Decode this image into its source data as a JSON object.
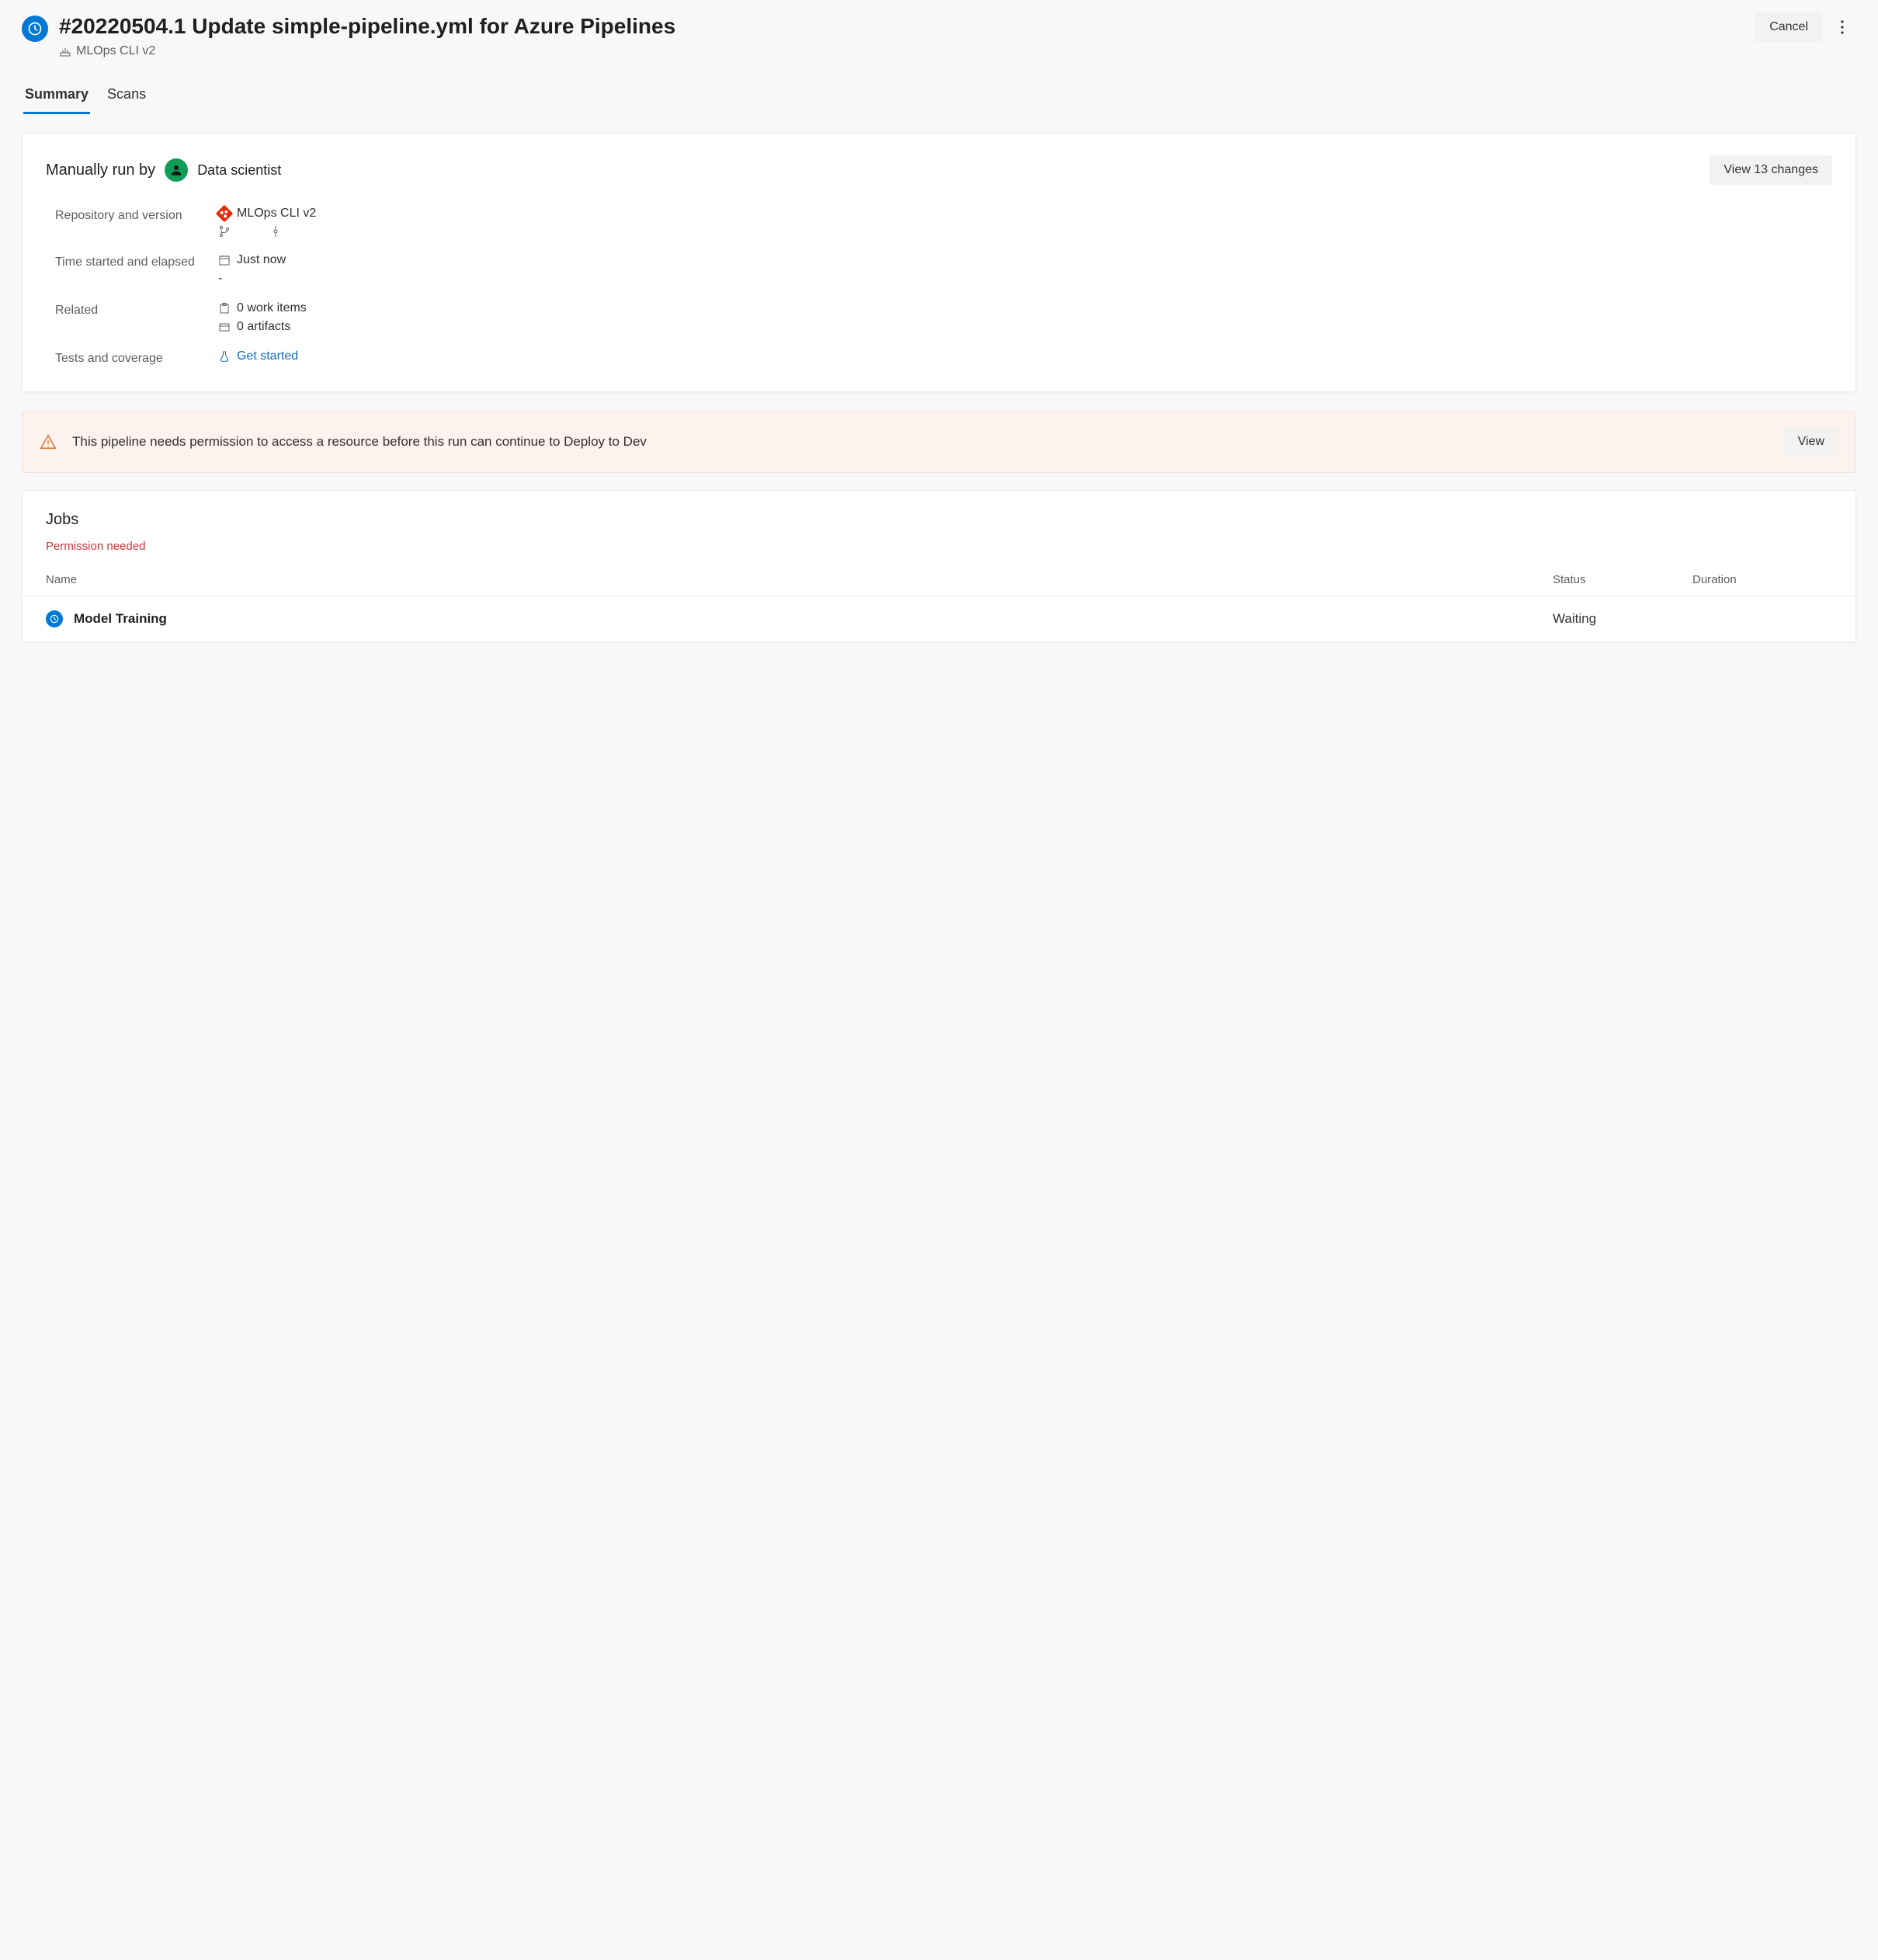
{
  "header": {
    "title": "#20220504.1 Update simple-pipeline.yml for Azure Pipelines",
    "pipeline_name": "MLOps CLI v2",
    "cancel_label": "Cancel"
  },
  "tabs": [
    {
      "label": "Summary",
      "active": true
    },
    {
      "label": "Scans",
      "active": false
    }
  ],
  "summary": {
    "run_by_label": "Manually run by",
    "run_by_user": "Data scientist",
    "view_changes_label": "View 13 changes",
    "details": {
      "repo_label": "Repository and version",
      "repo_value": "MLOps CLI v2",
      "time_label": "Time started and elapsed",
      "time_started": "Just now",
      "time_elapsed": "-",
      "related_label": "Related",
      "work_items": "0 work items",
      "artifacts": "0 artifacts",
      "tests_label": "Tests and coverage",
      "tests_link": "Get started"
    }
  },
  "warning": {
    "text": "This pipeline needs permission to access a resource before this run can continue to Deploy to Dev",
    "view_label": "View"
  },
  "jobs": {
    "title": "Jobs",
    "permission_text": "Permission needed",
    "columns": {
      "name": "Name",
      "status": "Status",
      "duration": "Duration"
    },
    "rows": [
      {
        "name": "Model Training",
        "status": "Waiting",
        "duration": ""
      }
    ]
  }
}
